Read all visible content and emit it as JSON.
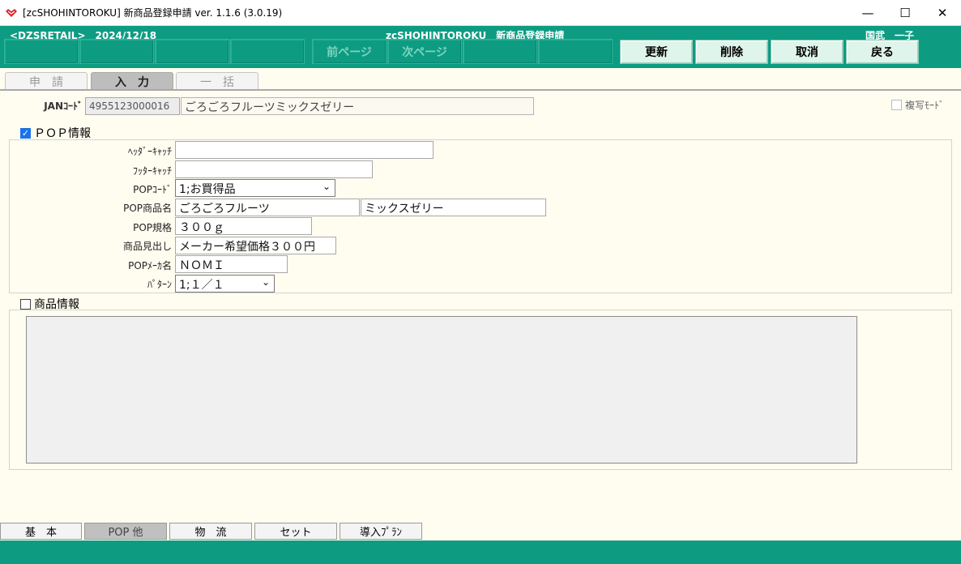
{
  "window": {
    "title": "[zcSHOHINTOROKU] 新商品登録申請 ver. 1.1.6 (3.0.19)",
    "controls": {
      "minimize": "—",
      "maximize": "☐",
      "close": "✕"
    }
  },
  "header": {
    "store": "<DZSRETAIL>　2024/12/18",
    "app_name": "zcSHOHINTOROKU　新商品登録申請",
    "user": "国武　一子"
  },
  "function_keys": [
    "",
    "",
    "",
    "",
    "前ページ",
    "次ページ",
    "",
    ""
  ],
  "actions": {
    "update": "更新",
    "delete": "削除",
    "cancel": "取消",
    "back": "戻る"
  },
  "top_tabs": [
    "申請",
    "入力",
    "一括"
  ],
  "form": {
    "jan_label": "JANｺｰﾄﾞ",
    "jan_code": "4955123000016",
    "jan_name": "ごろごろフルーツミックスゼリー",
    "copy_mode_label": "複写ﾓｰﾄﾞ"
  },
  "pop": {
    "section_label": "ＰＯＰ情報",
    "header_catch_label": "ﾍｯﾀﾞｰｷｬｯﾁ",
    "header_catch": "",
    "footer_catch_label": "ﾌｯﾀｰｷｬｯﾁ",
    "footer_catch": "",
    "pop_code_label": "POPｺｰﾄﾞ",
    "pop_code": "1;お買得品",
    "pop_name_label": "POP商品名",
    "pop_name_1": "ごろごろフルーツ",
    "pop_name_2": "ミックスゼリー",
    "spec_label": "POP規格",
    "spec": "３００ｇ",
    "headline_label": "商品見出し",
    "headline": "メーカー希望価格３００円",
    "maker_label": "POPﾒｰｶ名",
    "maker": "ＮＯＭＩ",
    "pattern_label": "ﾊﾟﾀｰﾝ",
    "pattern": "1;１／１"
  },
  "product_info": {
    "section_label": "商品情報"
  },
  "bottom_tabs": [
    "基　本",
    "POP 他",
    "物　流",
    "セット",
    "導入ﾌﾟﾗﾝ"
  ],
  "colors": {
    "header": "#0d9c82",
    "background": "#fffcf0"
  }
}
